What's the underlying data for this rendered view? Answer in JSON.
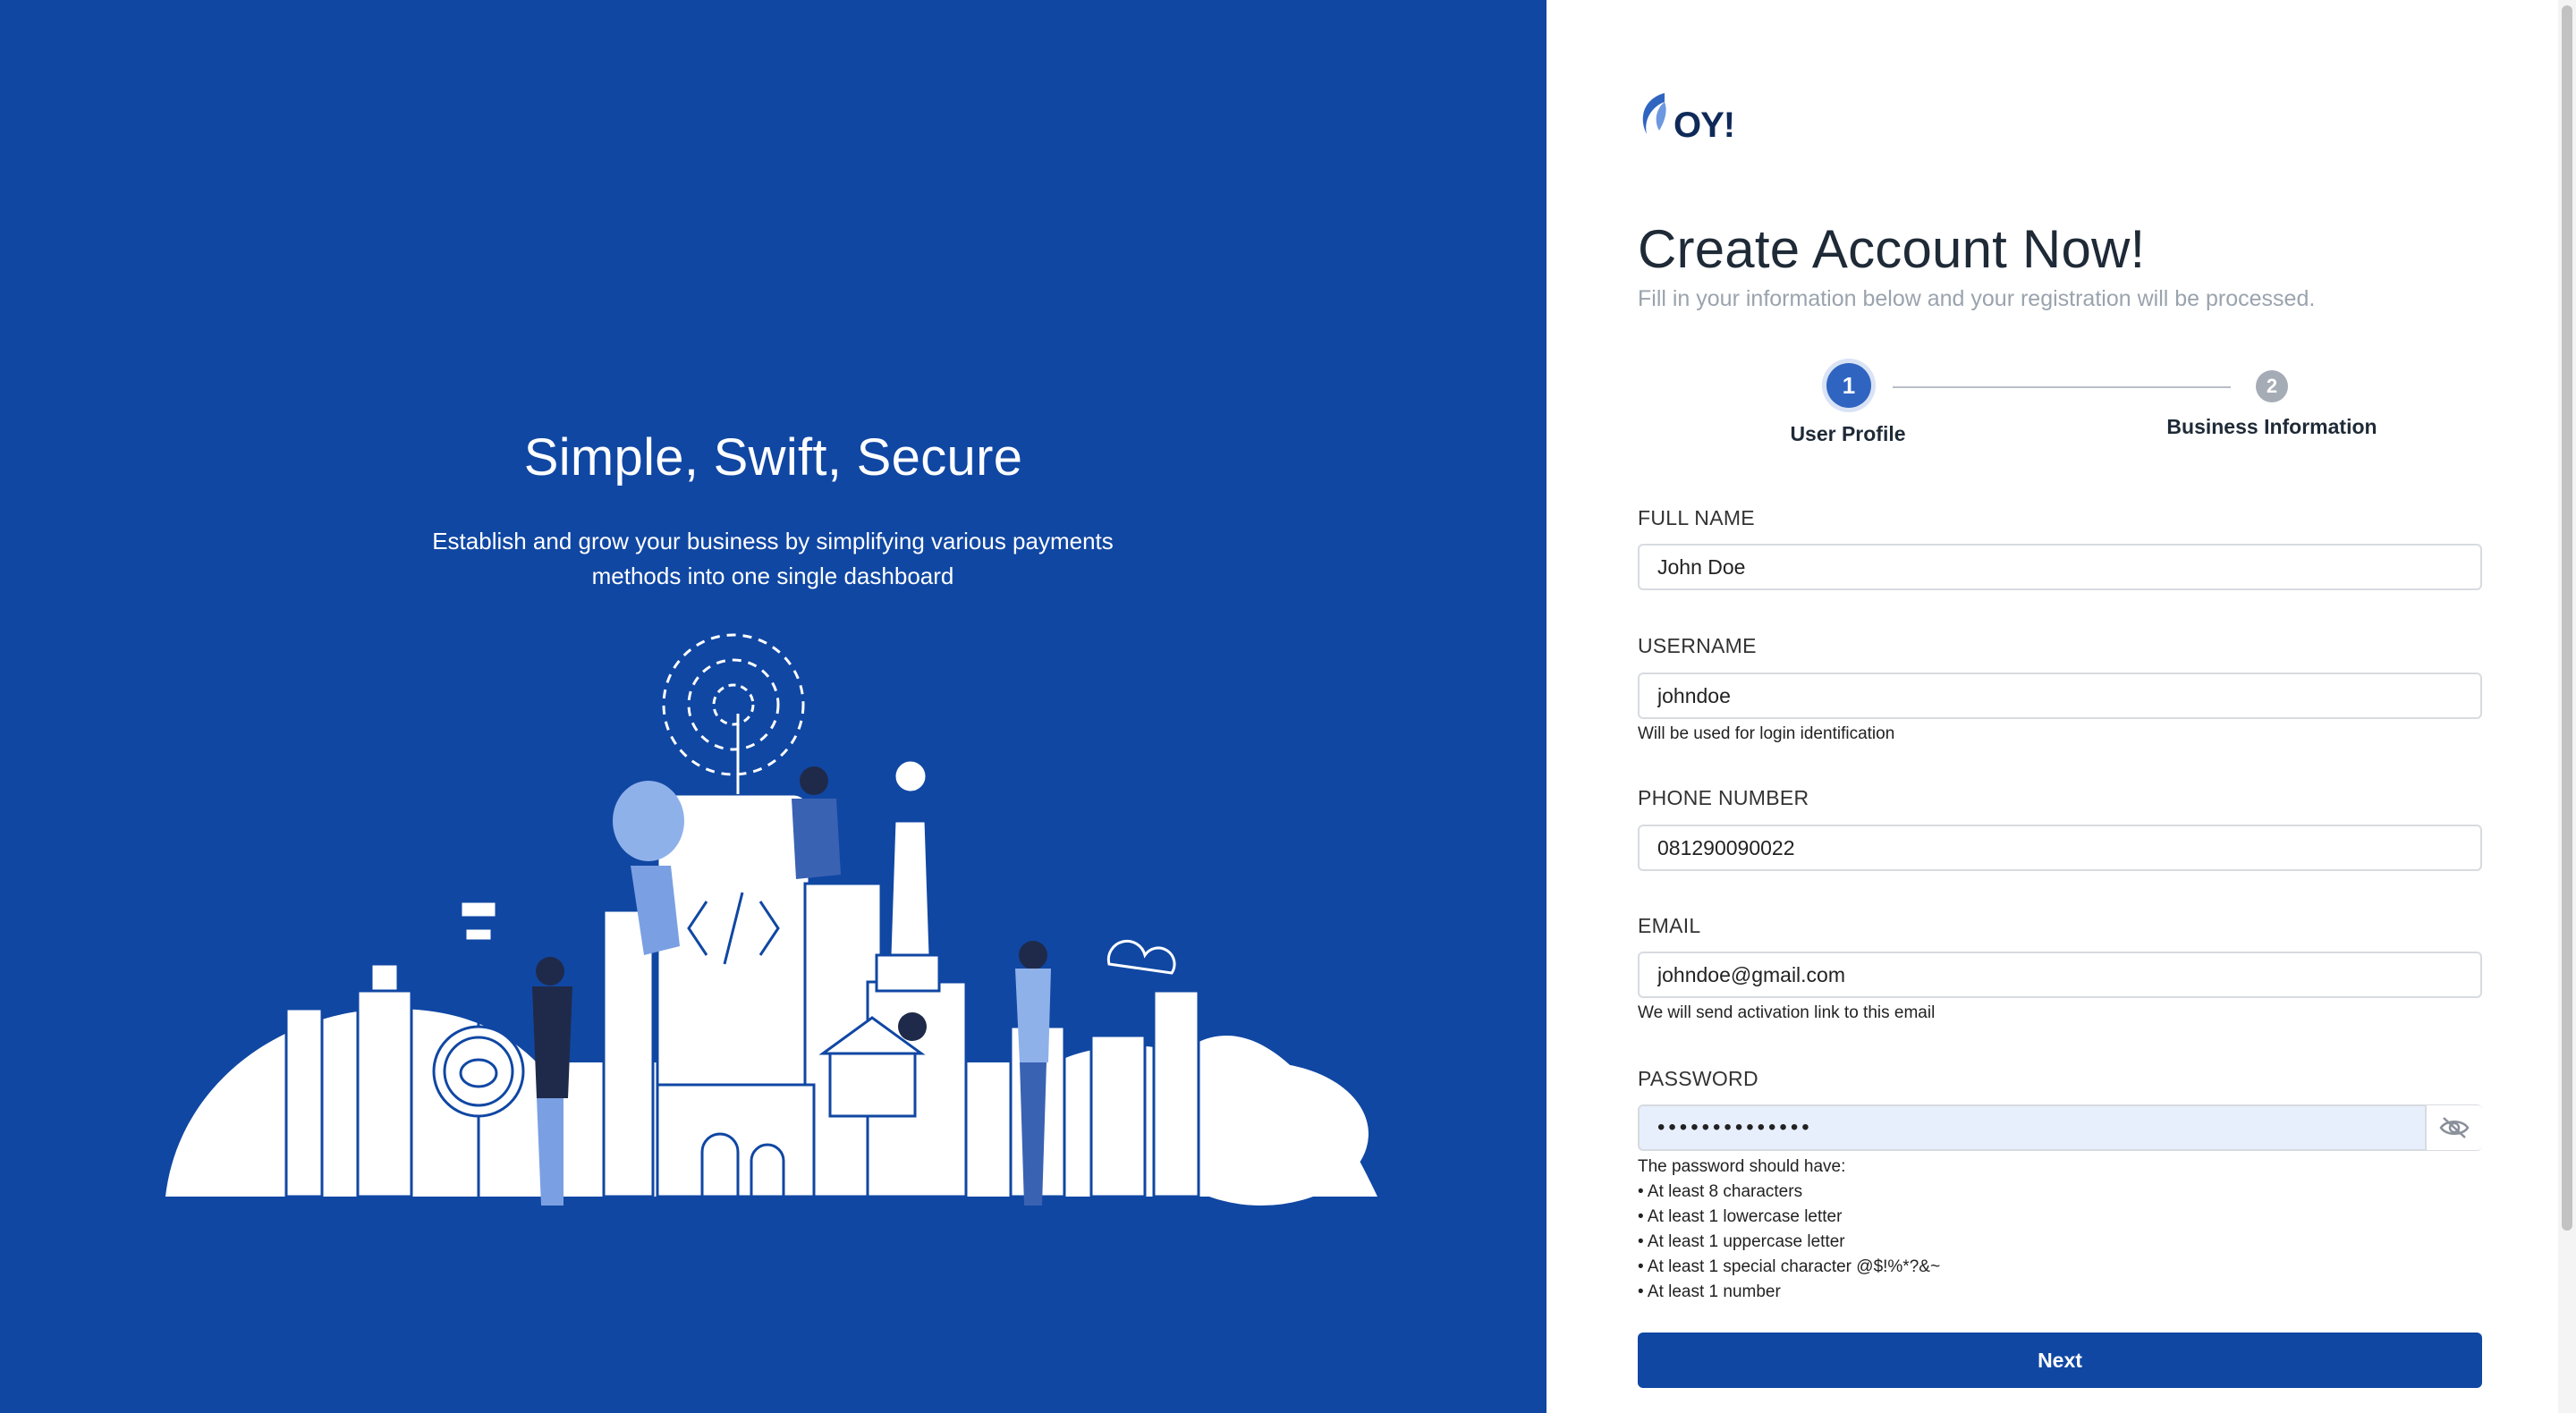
{
  "hero": {
    "title": "Simple, Swift, Secure",
    "subtitle_line1": "Establish and grow your business by simplifying various payments",
    "subtitle_line2": "methods into one single dashboard"
  },
  "brand": {
    "logo_text": "OY!",
    "primary_color": "#1047a3",
    "accent_color": "#2f65c0"
  },
  "form": {
    "title": "Create Account Now!",
    "subtitle": "Fill in your information below and your registration will be processed.",
    "steps": [
      {
        "number": "1",
        "label": "User Profile",
        "active": true
      },
      {
        "number": "2",
        "label": "Business Information",
        "active": false
      }
    ],
    "fields": {
      "full_name": {
        "label": "FULL NAME",
        "value": "John Doe"
      },
      "username": {
        "label": "USERNAME",
        "value": "johndoe",
        "help": "Will be used for login identification"
      },
      "phone": {
        "label": "PHONE NUMBER",
        "value": "081290090022"
      },
      "email": {
        "label": "EMAIL",
        "value": "johndoe@gmail.com",
        "help": "We will send activation link to this email"
      },
      "password": {
        "label": "PASSWORD",
        "value": "••••••••••••••",
        "toggle_icon": "eye-off-icon"
      }
    },
    "password_rules": {
      "heading": "The password should have:",
      "items": [
        "At least 8 characters",
        "At least 1 lowercase letter",
        "At least 1 uppercase letter",
        "At least 1 special character @$!%*?&~",
        "At least 1 number"
      ]
    },
    "next_label": "Next"
  }
}
